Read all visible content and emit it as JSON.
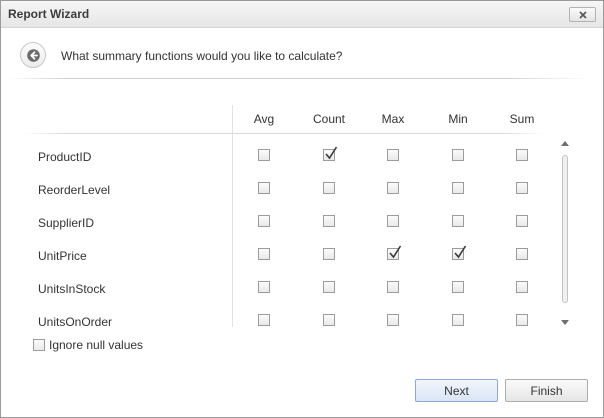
{
  "window": {
    "title": "Report Wizard"
  },
  "question": "What summary functions would you like to calculate?",
  "columns": [
    "Avg",
    "Count",
    "Max",
    "Min",
    "Sum"
  ],
  "rows": [
    {
      "field": "ProductID",
      "checks": [
        false,
        true,
        false,
        false,
        false
      ]
    },
    {
      "field": "ReorderLevel",
      "checks": [
        false,
        false,
        false,
        false,
        false
      ]
    },
    {
      "field": "SupplierID",
      "checks": [
        false,
        false,
        false,
        false,
        false
      ]
    },
    {
      "field": "UnitPrice",
      "checks": [
        false,
        false,
        true,
        true,
        false
      ]
    },
    {
      "field": "UnitsInStock",
      "checks": [
        false,
        false,
        false,
        false,
        false
      ]
    },
    {
      "field": "UnitsOnOrder",
      "checks": [
        false,
        false,
        false,
        false,
        false
      ]
    }
  ],
  "ignore_null": {
    "label": "Ignore null values",
    "checked": false
  },
  "buttons": {
    "next": "Next",
    "finish": "Finish"
  },
  "icons": {
    "close": "close-icon",
    "back": "back-arrow-icon",
    "check": "checkmark-icon"
  }
}
